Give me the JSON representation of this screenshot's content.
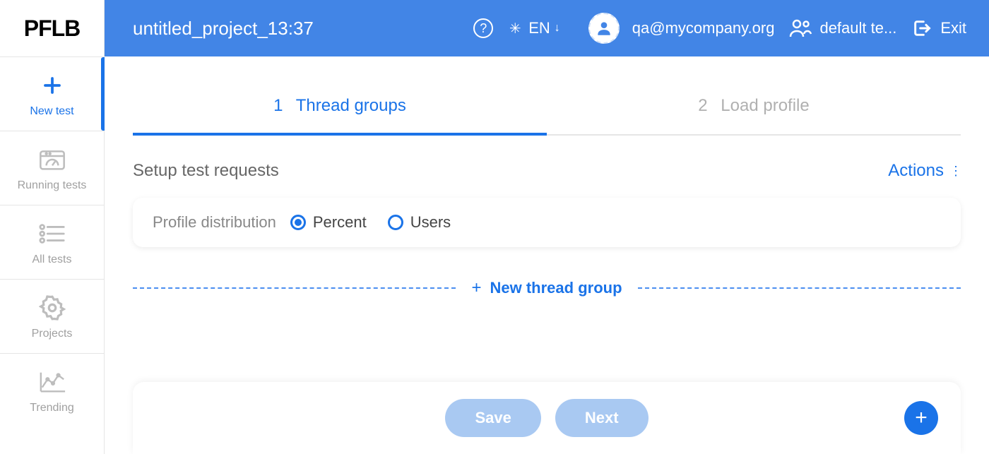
{
  "brand": "PFLB",
  "header": {
    "project_title": "untitled_project_13:37",
    "language": "EN",
    "user_email": "qa@mycompany.org",
    "team_label": "default te...",
    "exit_label": "Exit"
  },
  "sidebar": {
    "items": [
      {
        "label": "New test",
        "icon": "plus-icon",
        "active": true
      },
      {
        "label": "Running tests",
        "icon": "gauge-icon",
        "active": false
      },
      {
        "label": "All tests",
        "icon": "list-icon",
        "active": false
      },
      {
        "label": "Projects",
        "icon": "gear-icon",
        "active": false
      },
      {
        "label": "Trending",
        "icon": "chart-icon",
        "active": false
      }
    ]
  },
  "tabs": [
    {
      "num": "1",
      "label": "Thread groups",
      "active": true
    },
    {
      "num": "2",
      "label": "Load profile",
      "active": false
    }
  ],
  "section": {
    "title": "Setup test requests",
    "actions_label": "Actions"
  },
  "distribution": {
    "label": "Profile distribution",
    "options": [
      {
        "label": "Percent",
        "selected": true
      },
      {
        "label": "Users",
        "selected": false
      }
    ]
  },
  "new_thread_group_label": "New thread group",
  "buttons": {
    "save": "Save",
    "next": "Next"
  }
}
